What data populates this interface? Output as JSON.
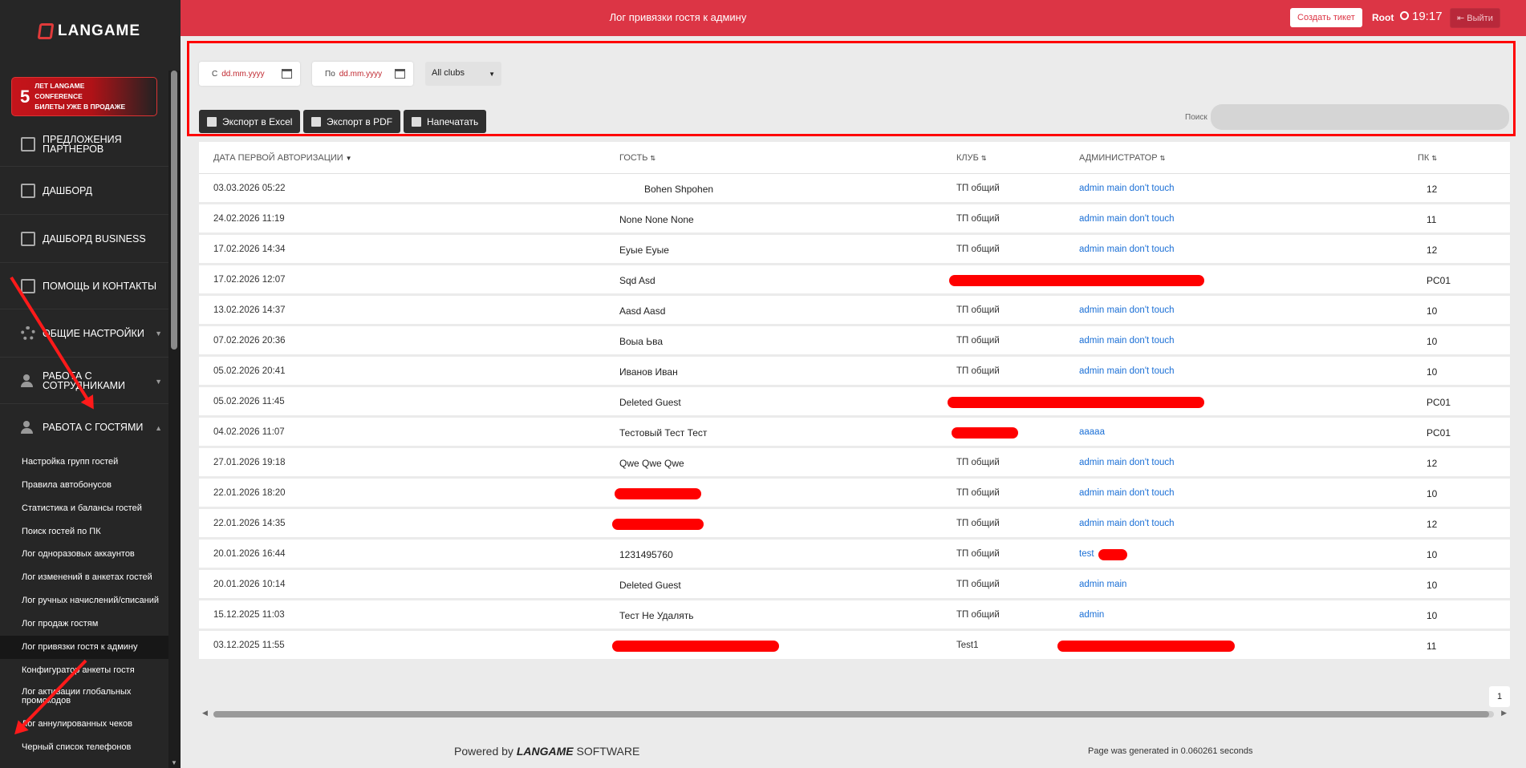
{
  "sidebar": {
    "logo_text": "LANGAME",
    "banner_number": "5",
    "banner_text": "ЛЕТ LANGAME\nCONFERENCE\nБИЛЕТЫ УЖЕ В ПРОДАЖЕ",
    "nav": [
      {
        "label": "ПРЕДЛОЖЕНИЯ ПАРТНЕРОВ",
        "icon": "edit-icon"
      },
      {
        "label": "ДАШБОРД",
        "icon": "book-icon"
      },
      {
        "label": "ДАШБОРД BUSINESS",
        "icon": "edit-icon"
      },
      {
        "label": "ПОМОЩЬ И КОНТАКТЫ",
        "icon": "edit-icon"
      },
      {
        "label": "ОБЩИЕ НАСТРОЙКИ",
        "icon": "gear-icon"
      },
      {
        "label": "РАБОТА С СОТРУДНИКАМИ",
        "icon": "users-icon"
      },
      {
        "label": "РАБОТА С ГОСТЯМИ",
        "icon": "users-icon"
      }
    ],
    "sub_items": [
      "Настройка групп гостей",
      "Правила автобонусов",
      "Статистика и балансы гостей",
      "Поиск гостей по ПК",
      "Лог одноразовых аккаунтов",
      "Лог изменений в анкетах гостей",
      "Лог ручных начислений/списаний",
      "Лог продаж гостям",
      "Лог привязки гостя к админу",
      "Конфигуратор анкеты гостя",
      "Лог активации глобальных промокодов",
      "Лог аннулированных чеков",
      "Черный список телефонов"
    ]
  },
  "header": {
    "title": "Лог привязки гостя к админу",
    "ticket_button": "Создать тикет",
    "user": "Root",
    "time": "19:17",
    "logout_button": "Выйти"
  },
  "filters": {
    "from_prefix": "С",
    "from_value": "dd.mm.yyyy",
    "to_prefix": "По",
    "to_value": "dd.mm.yyyy",
    "club_select": "All clubs",
    "export_excel": "Экспорт в Excel",
    "export_pdf": "Экспорт в PDF",
    "print": "Напечатать",
    "search_label": "Поиск"
  },
  "table": {
    "columns": [
      "ДАТА ПЕРВОЙ АВТОРИЗАЦИИ",
      "ГОСТЬ",
      "КЛУБ",
      "АДМИНИСТРАТОР",
      "ПК"
    ],
    "rows": [
      {
        "date": "03.03.2026 05:22",
        "guest": "Bohen Shpohen",
        "club": "ТП общий",
        "admin": "admin main don't touch",
        "pc": "12"
      },
      {
        "date": "24.02.2026 11:19",
        "guest": "None None None",
        "club": "ТП общий",
        "admin": "admin main don't touch",
        "pc": "11"
      },
      {
        "date": "17.02.2026 14:34",
        "guest": "Еуые Еуые",
        "club": "ТП общий",
        "admin": "admin main don't touch",
        "pc": "12"
      },
      {
        "date": "17.02.2026 12:07",
        "guest": "Sqd Asd",
        "club": "",
        "admin": "",
        "pc": "PC01"
      },
      {
        "date": "13.02.2026 14:37",
        "guest": "Aasd Aasd",
        "club": "ТП общий",
        "admin": "admin main don't touch",
        "pc": "10"
      },
      {
        "date": "07.02.2026 20:36",
        "guest": "Вoыa Ьва",
        "club": "ТП общий",
        "admin": "admin main don't touch",
        "pc": "10"
      },
      {
        "date": "05.02.2026 20:41",
        "guest": "Иванов Иван",
        "club": "ТП общий",
        "admin": "admin main don't touch",
        "pc": "10"
      },
      {
        "date": "05.02.2026 11:45",
        "guest": "Deleted Guest",
        "club": "",
        "admin": "",
        "pc": "PC01"
      },
      {
        "date": "04.02.2026 11:07",
        "guest": "Тестовый Тест Тест",
        "club": "",
        "admin": "aaaaa",
        "pc": "PC01"
      },
      {
        "date": "27.01.2026 19:18",
        "guest": "Qwe Qwe Qwe",
        "club": "ТП общий",
        "admin": "admin main don't touch",
        "pc": "12"
      },
      {
        "date": "22.01.2026 18:20",
        "guest": "",
        "club": "ТП общий",
        "admin": "admin main don't touch",
        "pc": "10"
      },
      {
        "date": "22.01.2026 14:35",
        "guest": "",
        "club": "ТП общий",
        "admin": "admin main don't touch",
        "pc": "12"
      },
      {
        "date": "20.01.2026 16:44",
        "guest": "1231495760",
        "club": "ТП общий",
        "admin": "test",
        "pc": "10"
      },
      {
        "date": "20.01.2026 10:14",
        "guest": "Deleted Guest",
        "club": "ТП общий",
        "admin": "admin main",
        "pc": "10"
      },
      {
        "date": "15.12.2025 11:03",
        "guest": "Тест Не Удалять",
        "club": "ТП общий",
        "admin": "admin",
        "pc": "10"
      },
      {
        "date": "03.12.2025 11:55",
        "guest": "",
        "club": "Test1",
        "admin": "",
        "pc": "11"
      }
    ]
  },
  "pager": {
    "page": "1"
  },
  "footer": {
    "powered_prefix": "Powered by",
    "powered_brand": "LANGAME",
    "powered_suffix": "SOFTWARE",
    "generated": "Page was generated in 0.060261 seconds"
  },
  "colors": {
    "accent": "#dc3545",
    "sidebar": "#262626",
    "link": "#1a6fd6",
    "highlight": "#ff0000"
  }
}
